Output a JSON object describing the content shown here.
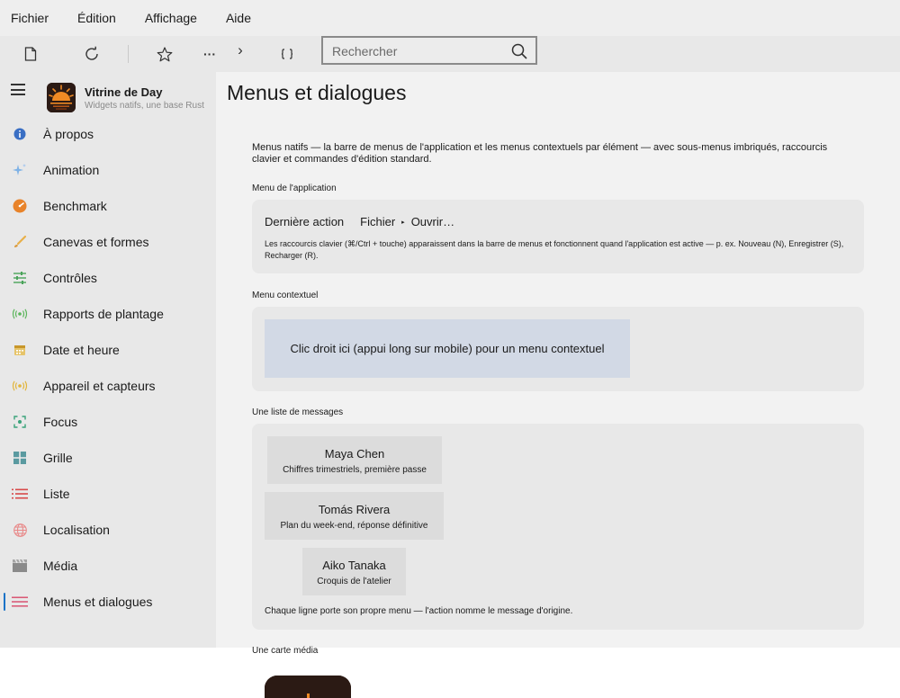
{
  "menubar": {
    "items": [
      "Fichier",
      "Édition",
      "Affichage",
      "Aide"
    ]
  },
  "toolbar": {
    "buttons": [
      {
        "icon": "new-document-icon"
      },
      {
        "icon": "reload-icon"
      },
      {
        "icon": "star-icon"
      },
      {
        "icon": "more-icon",
        "label": "···"
      },
      {
        "icon": "chevron-right-icon",
        "label": "›"
      },
      {
        "icon": "braces-icon"
      }
    ],
    "search_placeholder": "Rechercher"
  },
  "sidebar": {
    "app_title": "Vitrine de Day",
    "app_subtitle": "Widgets natifs, une base Rust",
    "items": [
      {
        "label": "À propos",
        "icon": "info-icon",
        "color": "#3a6fc4"
      },
      {
        "label": "Animation",
        "icon": "sparkle-icon",
        "color": "#7fb2e6"
      },
      {
        "label": "Benchmark",
        "icon": "gauge-icon",
        "color": "#e8832a"
      },
      {
        "label": "Canevas et formes",
        "icon": "brush-icon",
        "color": "#e8b04a"
      },
      {
        "label": "Contrôles",
        "icon": "sliders-icon",
        "color": "#4aa35a"
      },
      {
        "label": "Rapports de plantage",
        "icon": "broadcast-icon",
        "color": "#5bb55b"
      },
      {
        "label": "Date et heure",
        "icon": "calendar-icon",
        "color": "#d9a63a"
      },
      {
        "label": "Appareil et capteurs",
        "icon": "sensor-icon",
        "color": "#e2b53a"
      },
      {
        "label": "Focus",
        "icon": "focus-icon",
        "color": "#3aa37a"
      },
      {
        "label": "Grille",
        "icon": "grid-icon",
        "color": "#5a9aa0"
      },
      {
        "label": "Liste",
        "icon": "list-icon",
        "color": "#d84a4a"
      },
      {
        "label": "Localisation",
        "icon": "globe-icon",
        "color": "#e88a8a"
      },
      {
        "label": "Média",
        "icon": "clapper-icon",
        "color": "#8a8a8a"
      },
      {
        "label": "Menus et dialogues",
        "icon": "menu-lines-icon",
        "color": "#d84a6a",
        "active": true
      }
    ]
  },
  "main": {
    "title": "Menus et dialogues",
    "intro": "Menus natifs — la barre de menus de l'application et les menus contextuels par élément — avec sous-menus imbriqués, raccourcis clavier et commandes d'édition standard.",
    "app_menu": {
      "heading": "Menu de l'application",
      "last_action_label": "Dernière action",
      "crumb_1": "Fichier",
      "crumb_sep": "▸",
      "crumb_2": "Ouvrir…",
      "hint": "Les raccourcis clavier (⌘/Ctrl + touche) apparaissent dans la barre de menus et fonctionnent quand l'application est active — p. ex. Nouveau (N), Enregistrer (S), Recharger (R)."
    },
    "context_menu": {
      "heading": "Menu contextuel",
      "zone_text": "Clic droit ici (appui long sur mobile) pour un menu contextuel"
    },
    "messages": {
      "heading": "Une liste de messages",
      "items": [
        {
          "name": "Maya Chen",
          "preview": "Chiffres trimestriels, première passe"
        },
        {
          "name": "Tomás Rivera",
          "preview": "Plan du week-end, réponse définitive"
        },
        {
          "name": "Aiko Tanaka",
          "preview": "Croquis de l'atelier"
        }
      ],
      "footer": "Chaque ligne porte son propre menu — l'action nomme le message d'origine."
    },
    "media_card": {
      "heading": "Une carte média"
    }
  },
  "colors": {
    "accent": "#1a73c7",
    "sidebar_bg": "#e8e8e8",
    "content_bg": "#f2f2f2",
    "card_bg": "#e8e8e8",
    "context_zone_bg": "#d2d9e5",
    "logo_bg": "#2b1a14",
    "logo_sun": "#f08a24"
  }
}
